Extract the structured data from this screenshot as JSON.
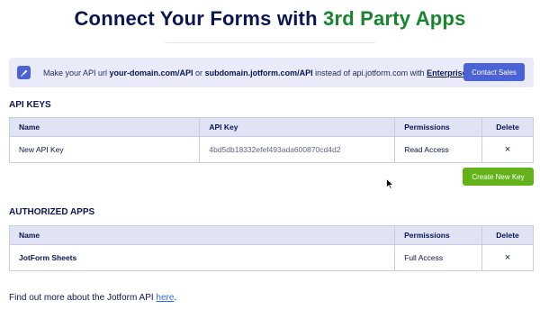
{
  "header": {
    "title_main": "Connect Your Forms with ",
    "title_accent": "3rd Party Apps"
  },
  "banner": {
    "icon": "rocket-icon",
    "text_1": "Make your API url ",
    "bold_1": "your-domain.com/API",
    "text_2": " or ",
    "bold_2": "subdomain.jotform.com/API",
    "text_3": " instead of api.jotform.com with ",
    "link_enterprise": "Enterprise",
    "text_4": ".",
    "contact_label": "Contact Sales"
  },
  "api_keys": {
    "section_title": "API KEYS",
    "headers": {
      "name": "Name",
      "key": "API Key",
      "permissions": "Permissions",
      "delete": "Delete"
    },
    "rows": [
      {
        "name": "New API Key",
        "key": "4bd5db18332efef493ada600870cd4d2",
        "permissions": "Read Access",
        "delete": "×"
      }
    ],
    "create_label": "Create New Key"
  },
  "authorized_apps": {
    "section_title": "AUTHORIZED APPS",
    "headers": {
      "name": "Name",
      "permissions": "Permissions",
      "delete": "Delete"
    },
    "rows": [
      {
        "name": "JotForm Sheets",
        "permissions": "Full Access",
        "delete": "×"
      }
    ]
  },
  "footer": {
    "text": "Find out more about the Jotform API ",
    "link": "here",
    "end": "."
  },
  "colors": {
    "navy": "#0a1551",
    "accent_green": "#18852e",
    "button_blue": "#4c63d8",
    "button_green": "#64b21a",
    "link_blue": "#2e69ff"
  }
}
